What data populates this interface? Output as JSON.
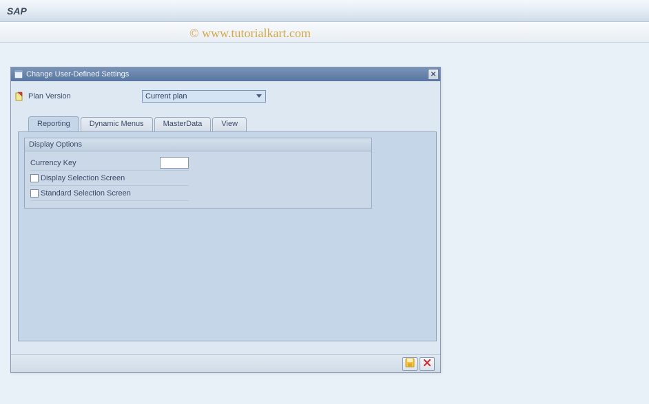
{
  "header": {
    "title": "SAP"
  },
  "watermark": "© www.tutorialkart.com",
  "dialog": {
    "title": "Change User-Defined Settings",
    "plan_version": {
      "label": "Plan Version",
      "value": "Current plan"
    },
    "tabs": {
      "reporting": "Reporting",
      "dynamic_menus": "Dynamic Menus",
      "master_data": "MasterData",
      "view": "View"
    },
    "display_options": {
      "title": "Display Options",
      "currency_key_label": "Currency Key",
      "currency_key_value": "",
      "display_selection_screen": "Display Selection Screen",
      "standard_selection_screen": "Standard Selection Screen"
    }
  }
}
